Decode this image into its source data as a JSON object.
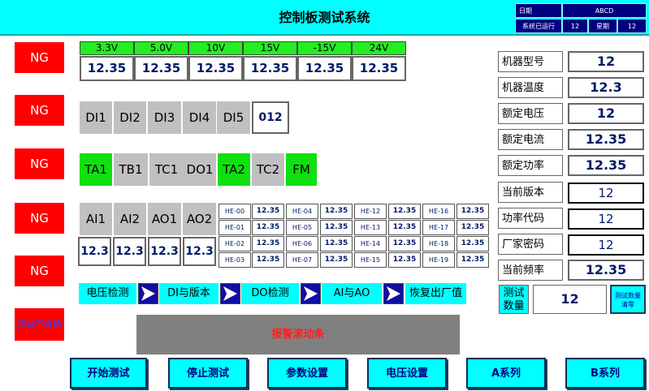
{
  "header": {
    "title": "控制板测试系统",
    "date_label": "日期",
    "date_value": "ABCD",
    "runtime_label": "系统已运行",
    "runtime_value": "12",
    "weekday_label": "星期",
    "weekday_value": "12"
  },
  "ng_labels": [
    "NG",
    "NG",
    "NG",
    "NG",
    "NG"
  ],
  "fail_label": "测试不合格",
  "voltages": {
    "labels": [
      "3.3V",
      "5.0V",
      "10V",
      "15V",
      "-15V",
      "24V"
    ],
    "values": [
      "12.35",
      "12.35",
      "12.35",
      "12.35",
      "12.35",
      "12.35"
    ]
  },
  "di": {
    "labels": [
      "DI1",
      "DI2",
      "DI3",
      "DI4",
      "DI5"
    ],
    "value": "012"
  },
  "relays": [
    "TA1",
    "TB1",
    "TC1",
    "DO1",
    "TA2",
    "TC2",
    "FM"
  ],
  "relay_colors": {
    "on": "#10e010",
    "off": "#c0c0c0"
  },
  "analog": {
    "labels": [
      "AI1",
      "AI2",
      "AO1",
      "AO2"
    ],
    "values": [
      "12.3",
      "12.3",
      "12.3",
      "12.3"
    ]
  },
  "he": {
    "labels": [
      [
        "HE-00",
        "HE-04",
        "HE-12",
        "HE-16"
      ],
      [
        "HE-01",
        "HE-05",
        "HE-13",
        "HE-17"
      ],
      [
        "HE-02",
        "HE-06",
        "HE-14",
        "HE-18"
      ],
      [
        "HE-03",
        "HE-07",
        "HE-15",
        "HE-19"
      ]
    ],
    "values": [
      [
        "12.35",
        "12.35",
        "12.35",
        "12.35"
      ],
      [
        "12.35",
        "12.35",
        "12.35",
        "12.35"
      ],
      [
        "12.35",
        "12.35",
        "12.35",
        "12.35"
      ],
      [
        "12.35",
        "12.35",
        "12.35",
        "12.35"
      ]
    ]
  },
  "steps": [
    "电压检测",
    "DI与版本",
    "DO检测",
    "AI与AO",
    "恢复出厂值"
  ],
  "alarm": "报警滚动条",
  "info": {
    "labels": [
      "机器型号",
      "机器温度",
      "额定电压",
      "额定电流",
      "额定功率",
      "当前版本",
      "功率代码",
      "厂家密码",
      "当前频率"
    ],
    "values": [
      "12",
      "12.3",
      "12",
      "12.35",
      "12.35",
      "12",
      "12",
      "12",
      "12.35"
    ]
  },
  "count": {
    "label": "测试数量",
    "value": "12",
    "clear_label": "测试数量清零"
  },
  "buttons": [
    "开始测试",
    "停止测试",
    "参数设置",
    "电压设置",
    "A系列",
    "B系列"
  ]
}
